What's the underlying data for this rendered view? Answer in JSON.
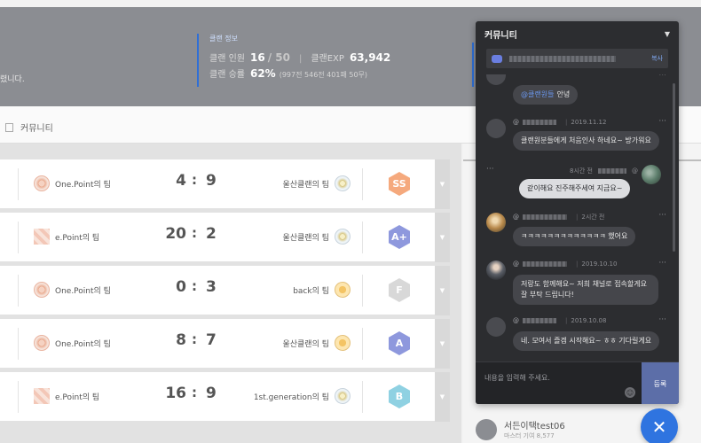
{
  "top_band": {
    "left_text": "렸니다.",
    "clan_info_title": "클랜 정보",
    "members_label": "클랜 인원",
    "members_current": "16",
    "members_max": "/ 50",
    "exp_label": "클랜EXP",
    "exp_value": "63,942",
    "winrate_label": "클랜 승률",
    "winrate_value": "62%",
    "winrate_detail": "(997전 546전 401패 50무)"
  },
  "tab_bar": {
    "label": "커뮤니티"
  },
  "matches": [
    {
      "team_a": "One.Point의 팀",
      "score_a": "4",
      "score_b": "9",
      "team_b": "울산클랜의 팀",
      "grade": "SS"
    },
    {
      "team_a": "e.Point의 팀",
      "score_a": "20",
      "score_b": "2",
      "team_b": "울산클랜의 팀",
      "grade": "A+"
    },
    {
      "team_a": "One.Point의 팀",
      "score_a": "0",
      "score_b": "3",
      "team_b": "back의 팀",
      "grade": "F"
    },
    {
      "team_a": "One.Point의 팀",
      "score_a": "8",
      "score_b": "7",
      "team_b": "울산클랜의 팀",
      "grade": "A"
    },
    {
      "team_a": "e.Point의 팀",
      "score_a": "16",
      "score_b": "9",
      "team_b": "1st.generation의 팀",
      "grade": "B"
    }
  ],
  "score_separator": ":",
  "member_preview": {
    "name": "서든이택test06",
    "sub": "마스터   기여 8,577"
  },
  "community": {
    "title": "커뮤니티",
    "copy_label": "복사",
    "messages": [
      {
        "mention": "@클랜원들",
        "text": "안녕",
        "date": ""
      },
      {
        "date": "2019.11.12",
        "text": "클랜원분들에게 처음인사 하네요~ 방가워요"
      },
      {
        "mine": true,
        "time": "8시간 전",
        "text": "같이해요 진주해주세여 지금요~"
      },
      {
        "date": "2시간 전",
        "text": "ㅋㅋㅋㅋㅋㅋㅋㅋㅋㅋㅋㅋㅋ 했어요"
      },
      {
        "date": "2019.10.10",
        "text": "저랑도 함께해요~ 저희 채널로 접속할게요 잘 부탁 드립니다!"
      },
      {
        "date": "2019.10.08",
        "text": "네. 모여서 즐겜 시작해요~ ㅎㅎ 기다릴게요"
      }
    ],
    "at_symbol": "@",
    "more_dots": "···",
    "input_placeholder": "내용을 입력해 주세요.",
    "submit_label": "등록"
  },
  "fab": {
    "label": "✕"
  },
  "colors": {
    "accent": "#2f74e0",
    "popup_bg": "#2c2d30",
    "mention": "#6a97ee",
    "submit_bg": "#5c6ea8"
  }
}
